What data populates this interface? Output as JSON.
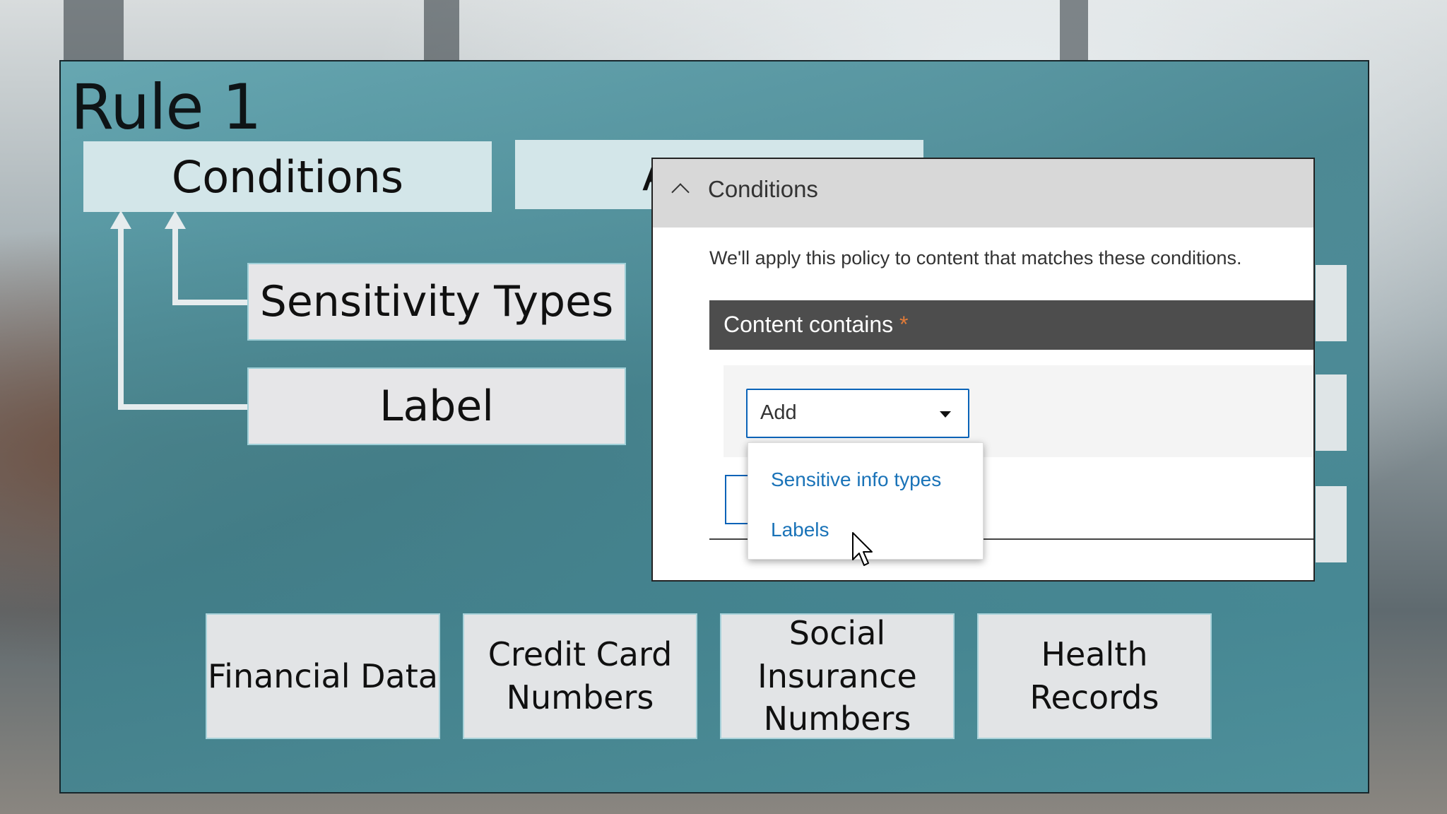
{
  "slide": {
    "title": "Rule 1",
    "conditions_box": "Conditions",
    "actions_box_partial": "A",
    "sensitivity_box": "Sensitivity Types",
    "label_box": "Label",
    "bottom_boxes": [
      {
        "line1": "Financial Data",
        "line2": "",
        "line3": ""
      },
      {
        "line1": "Credit Card",
        "line2": "Numbers",
        "line3": ""
      },
      {
        "line1": "Social",
        "line2": "Insurance",
        "line3": "Numbers"
      },
      {
        "line1": "Health",
        "line2": "Records",
        "line3": ""
      }
    ]
  },
  "dialog": {
    "header_title": "Conditions",
    "description": "We'll apply this policy to content that matches these conditions.",
    "content_contains_label": "Content contains",
    "required_marker": "*",
    "select_value": "Add",
    "menu_items": [
      "Sensitive info types",
      "Labels"
    ]
  },
  "colors": {
    "teal_panel": "#4f9aa6",
    "link_blue": "#1a73b8",
    "select_border": "#0a63b8",
    "required_orange": "#e07b39"
  }
}
